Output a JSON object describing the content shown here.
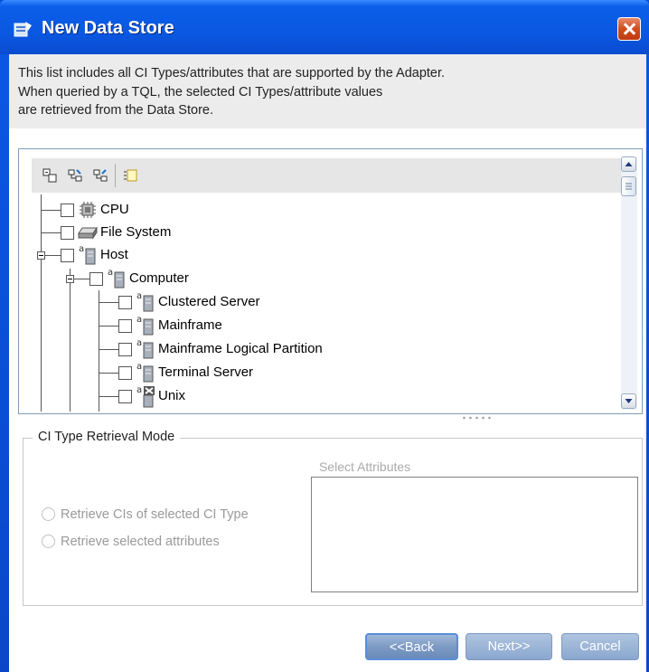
{
  "window": {
    "title": "New Data Store"
  },
  "description": {
    "line1": "This list includes all CI Types/attributes that are supported by the Adapter.",
    "line2": "When queried by a TQL, the selected CI Types/attribute values",
    "line3": "are retrieved from the Data Store."
  },
  "tree": {
    "nodes": [
      {
        "label": "CPU",
        "icon": "cpu-icon",
        "checked": false
      },
      {
        "label": "File System",
        "icon": "disk-icon",
        "checked": false
      },
      {
        "label": "Host",
        "icon": "server-icon",
        "checked": false,
        "expanded": true
      },
      {
        "label": "Computer",
        "icon": "server-icon",
        "checked": false,
        "expanded": true
      },
      {
        "label": "Clustered Server",
        "icon": "server-icon",
        "checked": false
      },
      {
        "label": "Mainframe",
        "icon": "server-icon",
        "checked": false
      },
      {
        "label": "Mainframe Logical Partition",
        "icon": "server-icon",
        "checked": false
      },
      {
        "label": "Terminal Server",
        "icon": "server-icon",
        "checked": false
      },
      {
        "label": "Unix",
        "icon": "unix-server-icon",
        "checked": false
      }
    ]
  },
  "retrieval": {
    "legend": "CI Type Retrieval Mode",
    "option1": "Retrieve CIs of selected CI Type",
    "option2": "Retrieve selected attributes",
    "attributes_label": "Select Attributes"
  },
  "buttons": {
    "back": "<<Back",
    "next": "Next>>",
    "cancel": "Cancel"
  },
  "colors": {
    "titlebar": "#0b58e2",
    "button": "#8ba7cf"
  }
}
